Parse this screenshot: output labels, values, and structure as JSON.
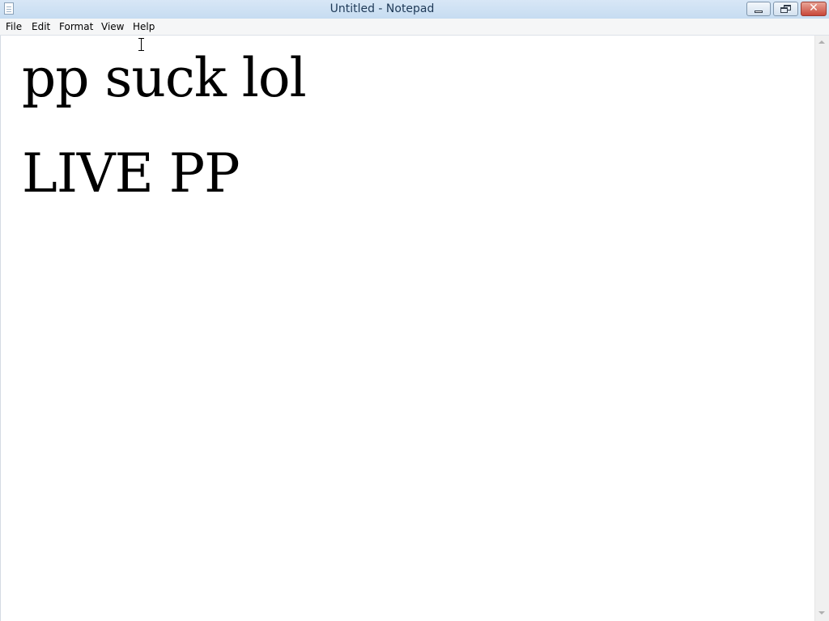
{
  "window": {
    "title": "Untitled - Notepad",
    "app_icon": "notepad-icon",
    "buttons": {
      "minimize": "minimize-icon",
      "restore": "restore-icon",
      "close": "close-icon",
      "close_glyph": "✕"
    }
  },
  "menubar": {
    "items": [
      {
        "label": "File"
      },
      {
        "label": "Edit"
      },
      {
        "label": "Format"
      },
      {
        "label": "View"
      },
      {
        "label": "Help"
      }
    ]
  },
  "editor": {
    "lines": [
      "pp suck lol",
      "LIVE PP"
    ],
    "cursor_icon": "i-beam-cursor-icon"
  },
  "colors": {
    "titlebar": "#c6dcf1",
    "close_button": "#c8483a",
    "text": "#000000"
  }
}
